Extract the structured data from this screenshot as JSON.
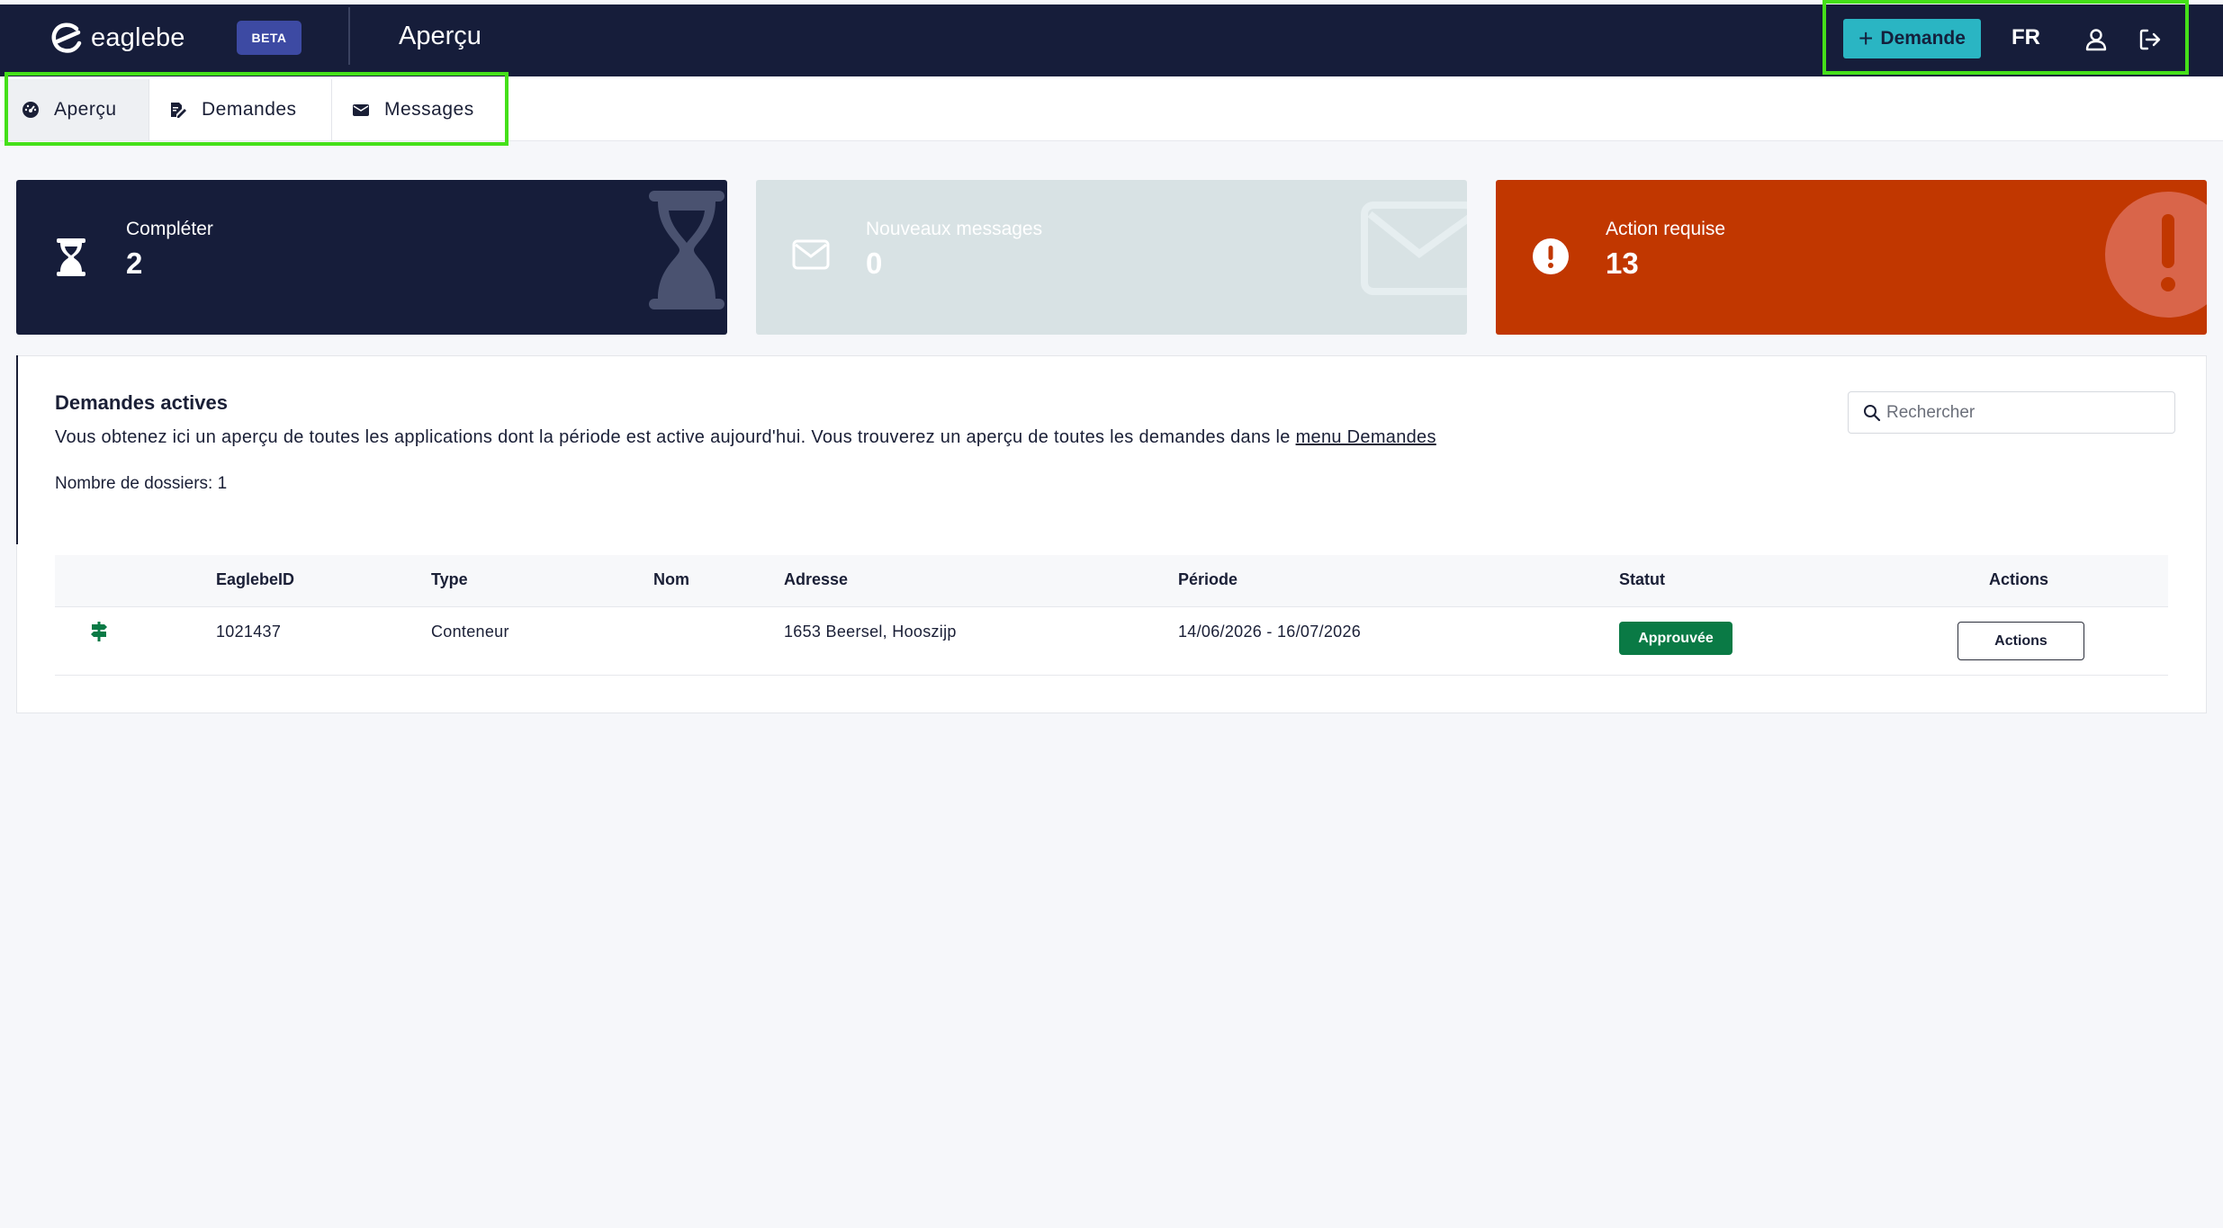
{
  "app": {
    "logo_text": "eaglebe",
    "beta_label": "BETA",
    "page_title": "Aperçu"
  },
  "header": {
    "new_request_label": "Demande",
    "language": "FR"
  },
  "tabs": [
    {
      "label": "Aperçu",
      "icon": "dashboard-icon",
      "active": true
    },
    {
      "label": "Demandes",
      "icon": "edit-document-icon",
      "active": false
    },
    {
      "label": "Messages",
      "icon": "envelope-icon",
      "active": false
    }
  ],
  "cards": [
    {
      "label": "Compléter",
      "value": "2",
      "icon": "hourglass-icon",
      "color": "#161d3a"
    },
    {
      "label": "Nouveaux messages",
      "value": "0",
      "icon": "envelope-icon",
      "color": "#d8e2e4"
    },
    {
      "label": "Action requise",
      "value": "13",
      "icon": "exclamation-circle-icon",
      "color": "#c13700"
    }
  ],
  "panel": {
    "title": "Demandes actives",
    "description": "Vous obtenez ici un aperçu de toutes les applications dont la période est active aujourd'hui. Vous trouverez un aperçu de toutes les demandes dans le",
    "link_text": "menu Demandes",
    "count_text": "Nombre de dossiers: 1",
    "search_placeholder": "Rechercher"
  },
  "table": {
    "columns": [
      "EaglebeID",
      "Type",
      "Nom",
      "Adresse",
      "Période",
      "Statut",
      "Actions"
    ],
    "rows": [
      {
        "id": "1021437",
        "type": "Conteneur",
        "name": "",
        "address": "1653 Beersel, Hooszijp",
        "period": "14/06/2026 - 16/07/2026",
        "status": "Approuvée",
        "action_label": "Actions"
      }
    ]
  },
  "colors": {
    "navy": "#161d3a",
    "accent": "#2ab5c3",
    "danger": "#c13700",
    "success": "#0a7a45",
    "highlight": "#45e019"
  }
}
